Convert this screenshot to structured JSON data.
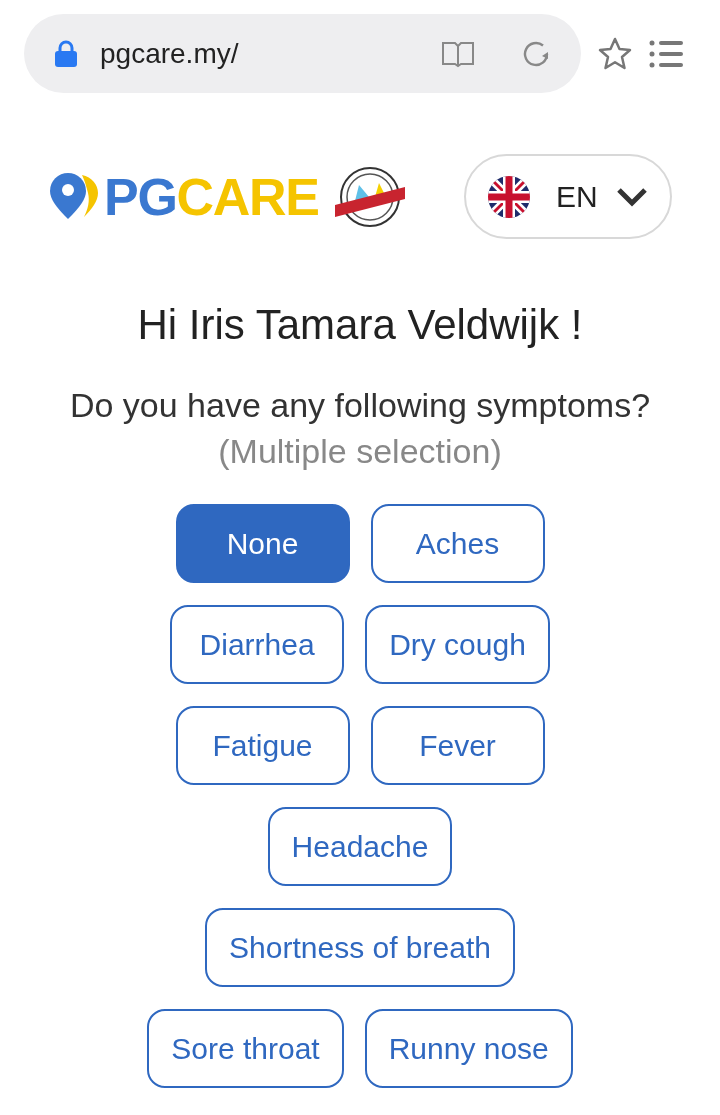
{
  "browser": {
    "url": "pgcare.my/"
  },
  "header": {
    "logo_left": "PG",
    "logo_right": "CARE",
    "language": "EN"
  },
  "greeting": "Hi Iris Tamara Veldwijk !",
  "question": "Do you have any following symptoms?",
  "question_hint": "(Multiple selection)",
  "symptom_rows": [
    [
      {
        "label": "None",
        "selected": true
      },
      {
        "label": "Aches",
        "selected": false
      }
    ],
    [
      {
        "label": "Diarrhea",
        "selected": false
      },
      {
        "label": "Dry cough",
        "selected": false
      }
    ],
    [
      {
        "label": "Fatigue",
        "selected": false
      },
      {
        "label": "Fever",
        "selected": false
      }
    ],
    [
      {
        "label": "Headache",
        "selected": false
      }
    ],
    [
      {
        "label": "Shortness of breath",
        "selected": false
      }
    ],
    [
      {
        "label": "Sore throat",
        "selected": false
      },
      {
        "label": "Runny nose",
        "selected": false
      }
    ]
  ]
}
